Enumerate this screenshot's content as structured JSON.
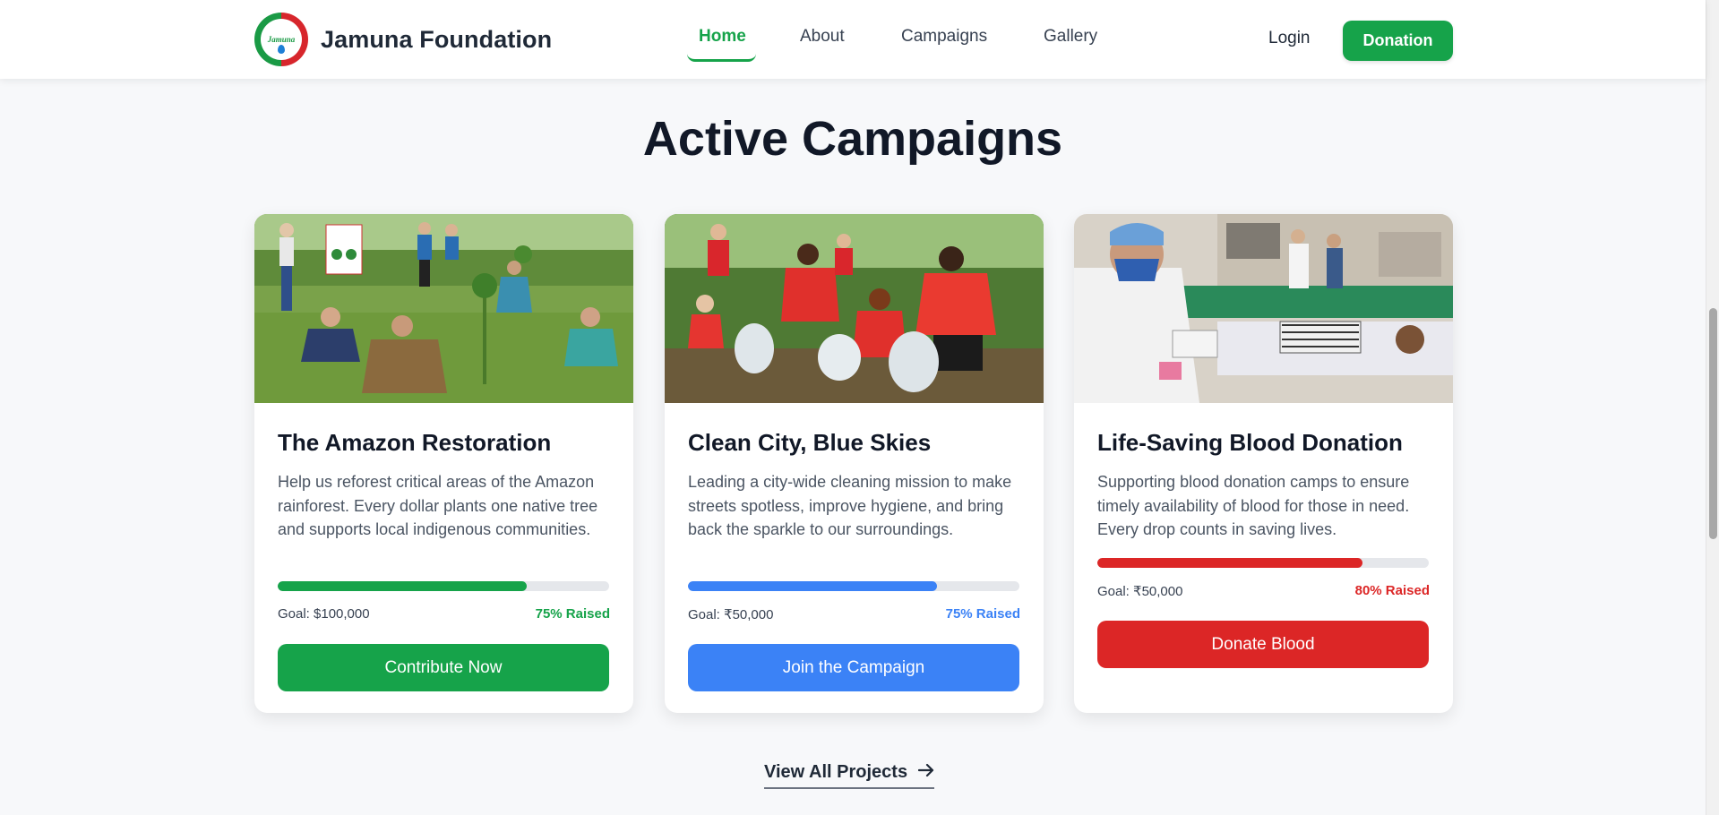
{
  "brand": {
    "name": "Jamuna Foundation",
    "logo_text": "Jamuna"
  },
  "nav": {
    "items": [
      {
        "label": "Home",
        "active": true
      },
      {
        "label": "About",
        "active": false
      },
      {
        "label": "Campaigns",
        "active": false
      },
      {
        "label": "Gallery",
        "active": false
      }
    ],
    "login_label": "Login",
    "donation_label": "Donation"
  },
  "section": {
    "title": "Active Campaigns"
  },
  "campaigns": [
    {
      "title": "The Amazon Restoration",
      "description": "Help us reforest critical areas of the Amazon rainforest. Every dollar plants one native tree and supports local indigenous communities.",
      "goal": "Goal: $100,000",
      "raised": "75% Raised",
      "progress": 0.75,
      "button": "Contribute Now",
      "color": "#16a34a",
      "image": "tree-planting-photo"
    },
    {
      "title": "Clean City, Blue Skies",
      "description": "Leading a city-wide cleaning mission to make streets spotless, improve hygiene, and bring back the sparkle to our surroundings.",
      "goal": "Goal: ₹50,000",
      "raised": "75% Raised",
      "progress": 0.75,
      "button": "Join the Campaign",
      "color": "#3b82f6",
      "image": "cleanup-volunteers-photo"
    },
    {
      "title": "Life-Saving Blood Donation",
      "description": "Supporting blood donation camps to ensure timely availability of blood for those in need. Every drop counts in saving lives.",
      "goal": "Goal: ₹50,000",
      "raised": "80% Raised",
      "progress": 0.8,
      "button": "Donate Blood",
      "color": "#dc2626",
      "image": "blood-donation-camp-photo"
    }
  ],
  "view_all": {
    "label": "View All Projects",
    "icon": "arrow-right-icon"
  },
  "colors": {
    "green": "#16a34a",
    "blue": "#3b82f6",
    "red": "#dc2626",
    "text": "#111827"
  }
}
